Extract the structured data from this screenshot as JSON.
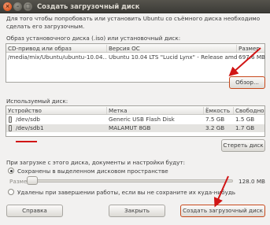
{
  "window": {
    "title": "Создать загрузочный диск",
    "close_glyph": "×",
    "min_glyph": "–",
    "max_glyph": "□"
  },
  "intro_text": "Для того чтобы попробовать или установить Ubuntu со съёмного диска необходимо сделать его загрузочным.",
  "source": {
    "label": "Образ установочного диска (.iso) или установочный диск:",
    "columns": [
      "CD-привод или образ",
      "Версия ОС",
      "Размер"
    ],
    "rows": [
      {
        "name": "/media/mix/Ubuntu/ubuntu-10.04...",
        "version": "Ubuntu 10.04 LTS \"Lucid Lynx\" - Release amd64 ...",
        "size": "697.6 MB"
      }
    ],
    "browse_button": "Обзор..."
  },
  "target": {
    "label": "Используемый диск:",
    "columns": [
      "Устройство",
      "Метка",
      "Ёмкость",
      "Свободно"
    ],
    "rows": [
      {
        "device": "/dev/sdb",
        "label": "Generic USB Flash Disk",
        "capacity": "7.5 GB",
        "free": "1.5 GB"
      },
      {
        "device": "/dev/sdb1",
        "label": "MALAMUT 8GB",
        "capacity": "3.2 GB",
        "free": "1.7 GB"
      }
    ],
    "erase_button": "Стереть диск"
  },
  "persistence": {
    "label": "При загрузке с этого диска, документы и настройки будут:",
    "option_save": "Сохранены в выделенном дисковом пространстве",
    "size_label": "Размер:",
    "size_value": "128.0 MB",
    "option_discard": "Удалены при завершении работы, если вы не сохраните их куда-нибудь",
    "selected": "save"
  },
  "buttons": {
    "help": "Справка",
    "close": "Закрыть",
    "create": "Создать загрузочный диск"
  },
  "colors": {
    "annotation_red": "#d11515",
    "title_bar": "#3c3b37",
    "window_bg": "#f2f1f0"
  }
}
